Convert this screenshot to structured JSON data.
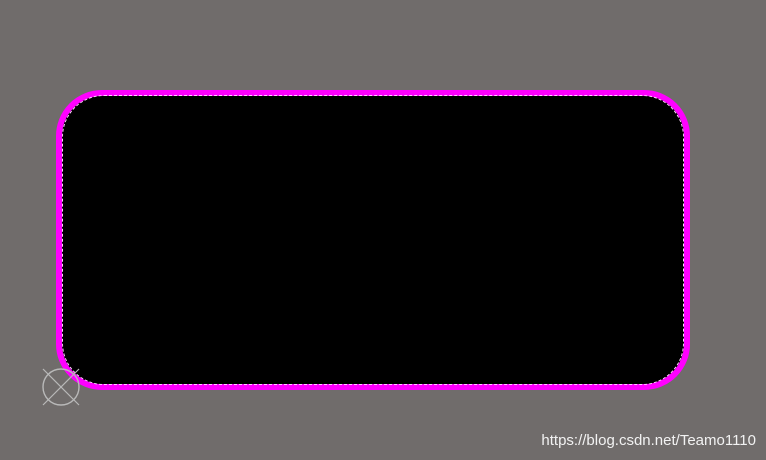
{
  "colors": {
    "background": "#706c6b",
    "board_fill": "#000000",
    "board_outline": "#ff00ff",
    "outline_dash": "#ffd6ff",
    "origin_marker": "#b9b9b9"
  },
  "icons": {
    "origin_marker": "origin-crosshair-icon"
  },
  "watermark": {
    "text": "https://blog.csdn.net/Teamo1110"
  }
}
